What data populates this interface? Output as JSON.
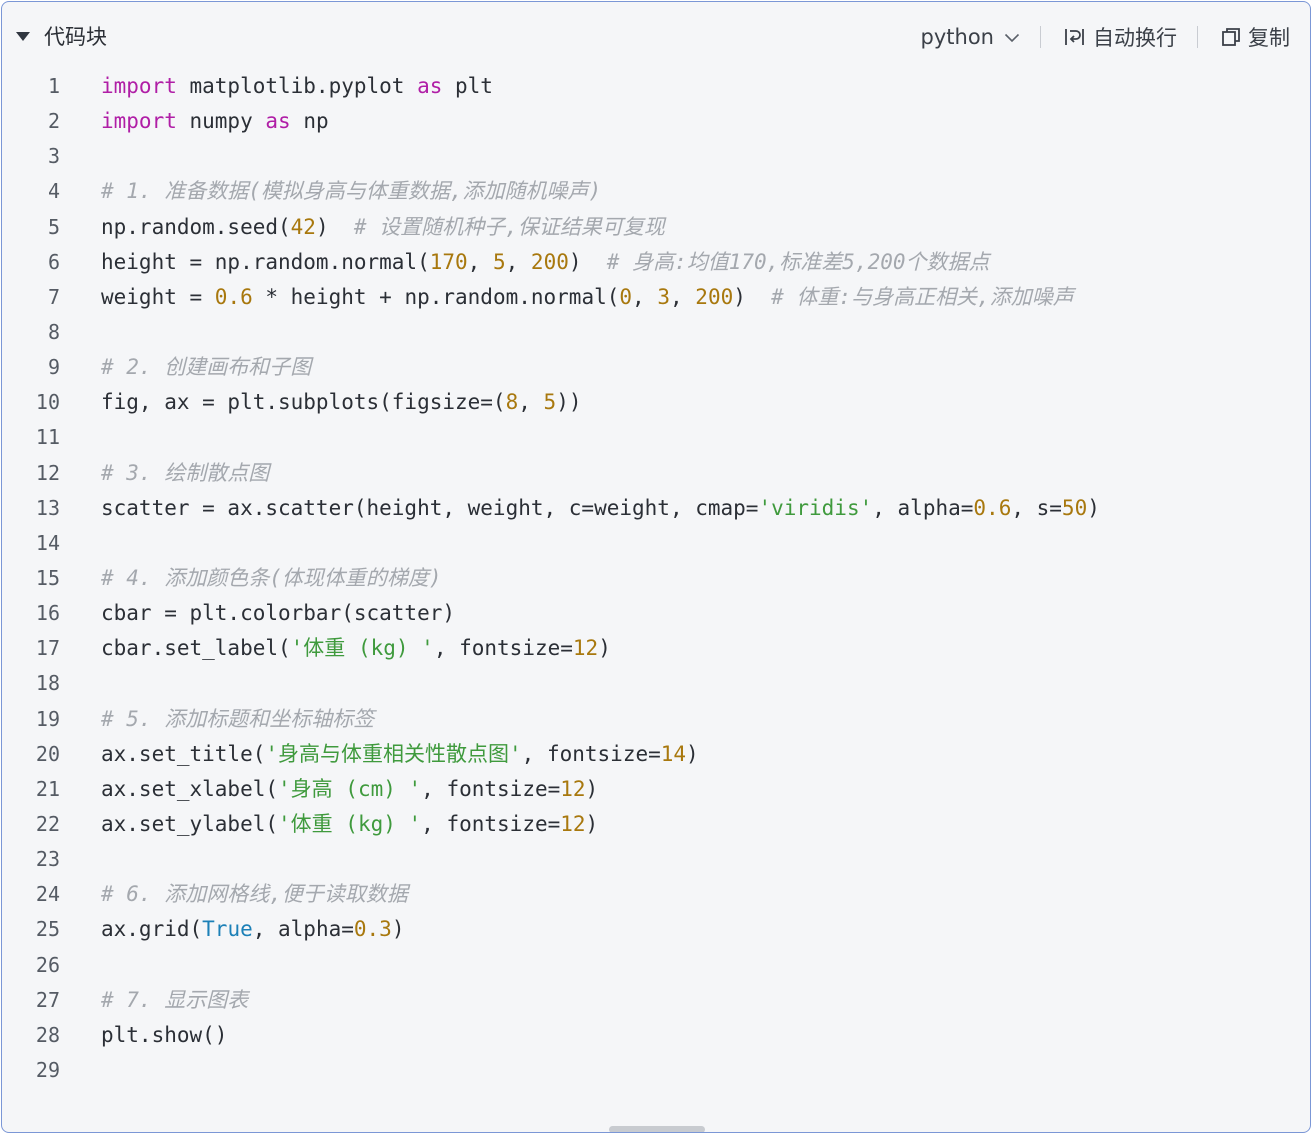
{
  "header": {
    "title": "代码块",
    "language": "python",
    "wrap_label": "自动换行",
    "copy_label": "复制"
  },
  "code_lines": [
    [
      [
        "kw",
        "import"
      ],
      [
        "t",
        " matplotlib.pyplot "
      ],
      [
        "kw",
        "as"
      ],
      [
        "t",
        " plt"
      ]
    ],
    [
      [
        "kw",
        "import"
      ],
      [
        "t",
        " numpy "
      ],
      [
        "kw",
        "as"
      ],
      [
        "t",
        " np"
      ]
    ],
    [],
    [
      [
        "cm",
        "# 1. 准备数据(模拟身高与体重数据,添加随机噪声)"
      ]
    ],
    [
      [
        "t",
        "np.random.seed("
      ],
      [
        "num",
        "42"
      ],
      [
        "t",
        ")  "
      ],
      [
        "cm",
        "# 设置随机种子,保证结果可复现"
      ]
    ],
    [
      [
        "t",
        "height = np.random.normal("
      ],
      [
        "num",
        "170"
      ],
      [
        "t",
        ", "
      ],
      [
        "num",
        "5"
      ],
      [
        "t",
        ", "
      ],
      [
        "num",
        "200"
      ],
      [
        "t",
        ")  "
      ],
      [
        "cm",
        "# 身高:均值170,标准差5,200个数据点"
      ]
    ],
    [
      [
        "t",
        "weight = "
      ],
      [
        "num",
        "0.6"
      ],
      [
        "t",
        " * height + np.random.normal("
      ],
      [
        "num",
        "0"
      ],
      [
        "t",
        ", "
      ],
      [
        "num",
        "3"
      ],
      [
        "t",
        ", "
      ],
      [
        "num",
        "200"
      ],
      [
        "t",
        ")  "
      ],
      [
        "cm",
        "# 体重:与身高正相关,添加噪声"
      ]
    ],
    [],
    [
      [
        "cm",
        "# 2. 创建画布和子图"
      ]
    ],
    [
      [
        "t",
        "fig, ax = plt.subplots(figsize=("
      ],
      [
        "num",
        "8"
      ],
      [
        "t",
        ", "
      ],
      [
        "num",
        "5"
      ],
      [
        "t",
        "))"
      ]
    ],
    [],
    [
      [
        "cm",
        "# 3. 绘制散点图"
      ]
    ],
    [
      [
        "t",
        "scatter = ax.scatter(height, weight, c=weight, cmap="
      ],
      [
        "str",
        "'viridis'"
      ],
      [
        "t",
        ", alpha="
      ],
      [
        "num",
        "0.6"
      ],
      [
        "t",
        ", s="
      ],
      [
        "num",
        "50"
      ],
      [
        "t",
        ")"
      ]
    ],
    [],
    [
      [
        "cm",
        "# 4. 添加颜色条(体现体重的梯度)"
      ]
    ],
    [
      [
        "t",
        "cbar = plt.colorbar(scatter)"
      ]
    ],
    [
      [
        "t",
        "cbar.set_label("
      ],
      [
        "str",
        "'体重 (kg) '"
      ],
      [
        "t",
        ", fontsize="
      ],
      [
        "num",
        "12"
      ],
      [
        "t",
        ")"
      ]
    ],
    [],
    [
      [
        "cm",
        "# 5. 添加标题和坐标轴标签"
      ]
    ],
    [
      [
        "t",
        "ax.set_title("
      ],
      [
        "str",
        "'身高与体重相关性散点图'"
      ],
      [
        "t",
        ", fontsize="
      ],
      [
        "num",
        "14"
      ],
      [
        "t",
        ")"
      ]
    ],
    [
      [
        "t",
        "ax.set_xlabel("
      ],
      [
        "str",
        "'身高 (cm) '"
      ],
      [
        "t",
        ", fontsize="
      ],
      [
        "num",
        "12"
      ],
      [
        "t",
        ")"
      ]
    ],
    [
      [
        "t",
        "ax.set_ylabel("
      ],
      [
        "str",
        "'体重 (kg) '"
      ],
      [
        "t",
        ", fontsize="
      ],
      [
        "num",
        "12"
      ],
      [
        "t",
        ")"
      ]
    ],
    [],
    [
      [
        "cm",
        "# 6. 添加网格线,便于读取数据"
      ]
    ],
    [
      [
        "t",
        "ax.grid("
      ],
      [
        "bool",
        "True"
      ],
      [
        "t",
        ", alpha="
      ],
      [
        "num",
        "0.3"
      ],
      [
        "t",
        ")"
      ]
    ],
    [],
    [
      [
        "cm",
        "# 7. 显示图表"
      ]
    ],
    [
      [
        "t",
        "plt.show()"
      ]
    ],
    []
  ]
}
